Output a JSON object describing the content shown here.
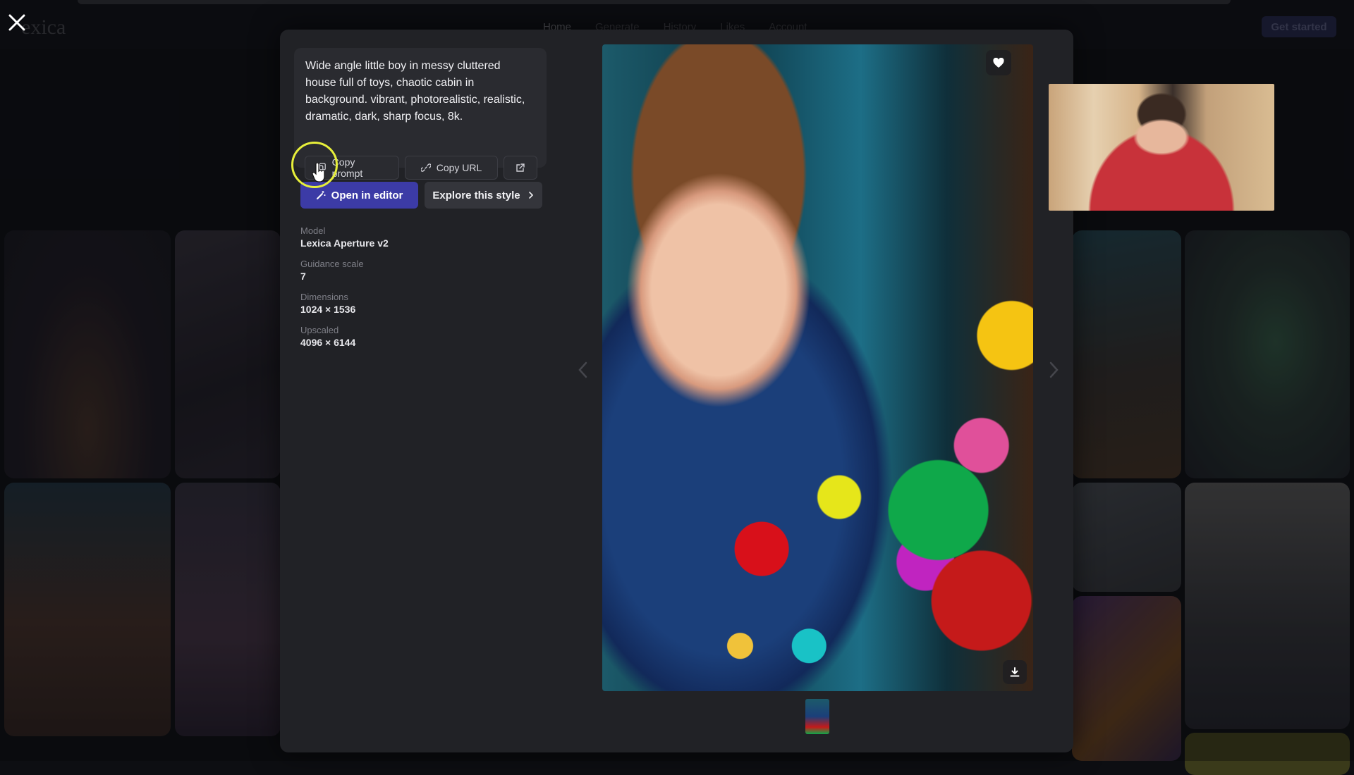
{
  "background": {
    "logo": "exica",
    "nav": [
      "Home",
      "Generate",
      "History",
      "Likes",
      "Account"
    ],
    "cta": "Get started"
  },
  "modal": {
    "prompt": "Wide angle little boy in messy cluttered house full of toys, chaotic cabin in background. vibrant, photorealistic, realistic, dramatic, dark, sharp focus, 8k.",
    "buttons": {
      "copy_prompt": "Copy prompt",
      "copy_url": "Copy URL",
      "open_in_editor": "Open in editor",
      "explore_style": "Explore this style"
    },
    "meta": {
      "model_label": "Model",
      "model_value": "Lexica Aperture v2",
      "guidance_label": "Guidance scale",
      "guidance_value": "7",
      "dimensions_label": "Dimensions",
      "dimensions_value": "1024 × 1536",
      "upscaled_label": "Upscaled",
      "upscaled_value": "4096 × 6144"
    }
  },
  "colors": {
    "primary_button": "#3c3ba6",
    "modal_bg": "#212226",
    "cursor_highlight": "#e7ef3a"
  },
  "icons": [
    "close-icon",
    "copy-icon",
    "link-icon",
    "external-link-icon",
    "wand-icon",
    "chevron-right-icon",
    "heart-icon",
    "download-icon",
    "chevron-left-icon"
  ]
}
